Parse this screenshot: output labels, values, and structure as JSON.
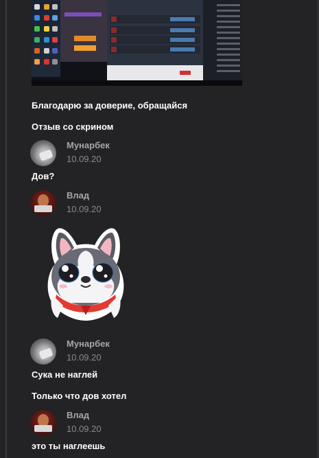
{
  "messages": [
    {
      "text": "Благодарю за доверие, обращайся"
    },
    {
      "text": "Отзыв со скрином"
    },
    {
      "author": "Мунарбек",
      "date": "10.09.20",
      "text": "Дов?"
    },
    {
      "author": "Влад",
      "date": "10.09.20",
      "sticker": "french-bulldog-sticker"
    },
    {
      "author": "Мунарбек",
      "date": "10.09.20",
      "text": "Сука не наглей"
    },
    {
      "text": "Только что дов хотел"
    },
    {
      "author": "Влад",
      "date": "10.09.20",
      "text": "это ты наглеешь"
    }
  ],
  "colors": {
    "background": "#232325",
    "author_name": "#a6a6a9",
    "date": "#8a8a8d",
    "message_text": "#ffffff"
  }
}
